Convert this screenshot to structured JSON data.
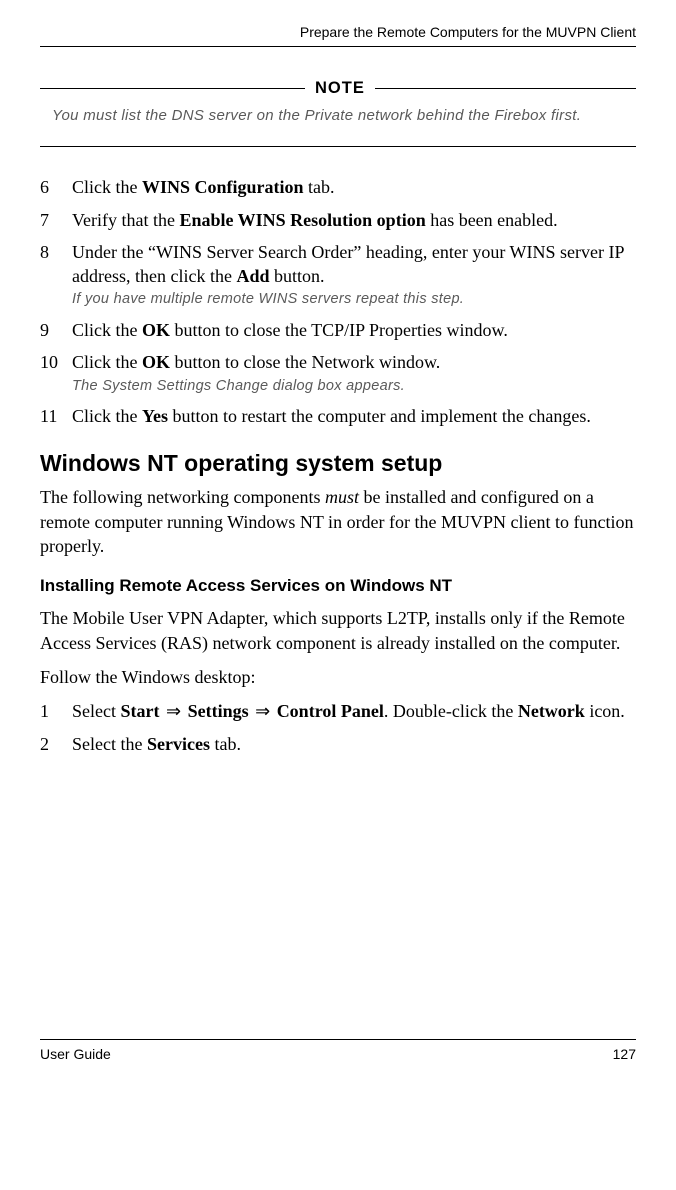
{
  "header": {
    "title": "Prepare the Remote Computers for the MUVPN Client"
  },
  "note": {
    "label": "NOTE",
    "prefix": "You ",
    "emph": "must",
    "rest": " list the DNS server on the Private network behind the Firebox first."
  },
  "steps_a": [
    {
      "num": "6",
      "pre": "Click the ",
      "bold": "WINS Configuration",
      "post": " tab."
    },
    {
      "num": "7",
      "pre": "Verify that the ",
      "bold": "Enable WINS Resolution option",
      "post": " has been enabled."
    },
    {
      "num": "8",
      "pre": "Under the “WINS Server Search Order” heading, enter your WINS server IP address, then click the ",
      "bold": "Add",
      "post": " button.",
      "sub": "If you have multiple remote WINS servers repeat this step."
    },
    {
      "num": "9",
      "pre": "Click the ",
      "bold": "OK",
      "post": " button to close the TCP/IP Properties window."
    },
    {
      "num": "10",
      "pre": "Click the ",
      "bold": "OK",
      "post": " button to close the Network window.",
      "sub": "The System Settings Change dialog box appears."
    },
    {
      "num": "11",
      "pre": "Click the ",
      "bold": "Yes",
      "post": " button to restart the computer and implement the changes."
    }
  ],
  "section": {
    "heading": "Windows NT operating system setup",
    "para_pre": "The following networking components ",
    "para_ital": "must",
    "para_post": " be installed and configured on a remote computer running Windows NT in order for the MUVPN client to function properly."
  },
  "subsection": {
    "heading": "Installing Remote Access Services on Windows NT",
    "para1": "The Mobile User VPN Adapter, which supports L2TP, installs only if the  Remote Access Services (RAS) network component is already installed on the computer.",
    "para2": "Follow the Windows desktop:"
  },
  "steps_b": [
    {
      "num": "1",
      "text_parts": [
        "Select ",
        "Start",
        " ",
        "⇒",
        " ",
        "Settings",
        " ",
        "⇒",
        " ",
        "Control Panel",
        ". Double-click the ",
        "Network",
        " icon."
      ],
      "bold_idx": [
        1,
        5,
        9,
        11
      ]
    },
    {
      "num": "2",
      "pre": "Select the ",
      "bold": "Services",
      "post": " tab."
    }
  ],
  "footer": {
    "left": "User Guide",
    "right": "127"
  }
}
